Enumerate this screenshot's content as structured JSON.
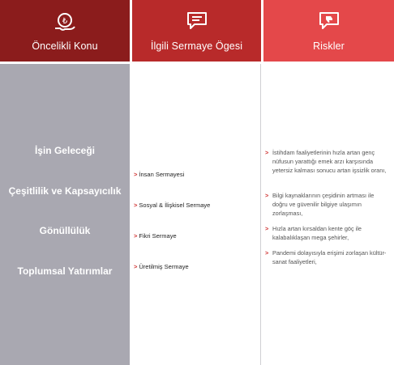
{
  "headers": {
    "priority": "Öncelikli Konu",
    "capital": "İlgili Sermaye Ögesi",
    "risks": "Riskler"
  },
  "topics": [
    "İşin Geleceği",
    "Çeşitlilik ve Kapsayıcılık",
    "Gönüllülük",
    "Toplumsal Yatırımlar"
  ],
  "capitals": [
    "İnsan Sermayesi",
    "Sosyal & İlişkisel Sermaye",
    "Fikri Sermaye",
    "Üretilmiş Sermaye"
  ],
  "risks": [
    "İstihdam faaliyetlerinin hızla artan genç nüfusun yarattığı emek arzı karşısında yetersiz kalması sonucu artan işsizlik oranı,",
    "Bilgi kaynaklarının çeşidinin artması ile doğru ve güvenilir bilgiye ulaşımın zorlaşması,",
    "Hızla artan kırsaldan kente göç ile kalabalıklaşan mega şehirler,",
    "Pandemi dolayısıyla erişimi zorlaşan kültür-sanat faaliyetleri,"
  ],
  "colors": {
    "header_dark": "#8b1c1c",
    "header_mid": "#b82a2a",
    "header_light": "#e4484a",
    "topic_column": "#a9a8b1",
    "accent_chevron": "#d0302f"
  },
  "icons": {
    "priority": "coin-hand-icon",
    "capital": "speech-bubble-icon",
    "risks": "thumbs-down-bubble-icon",
    "bullet": "chevron-right-icon"
  }
}
